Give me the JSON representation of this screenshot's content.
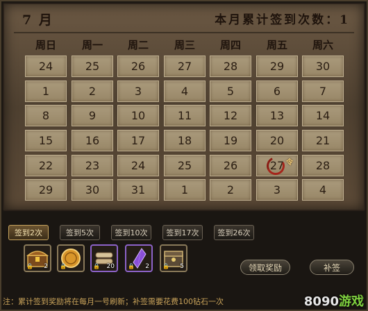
{
  "header": {
    "month": "7 月",
    "total_label": "本月累计签到次数：1"
  },
  "weekdays": [
    "周日",
    "周一",
    "周二",
    "周三",
    "周四",
    "周五",
    "周六"
  ],
  "calendar": [
    [
      "24",
      "25",
      "26",
      "27",
      "28",
      "29",
      "30"
    ],
    [
      "1",
      "2",
      "3",
      "4",
      "5",
      "6",
      "7"
    ],
    [
      "8",
      "9",
      "10",
      "11",
      "12",
      "13",
      "14"
    ],
    [
      "15",
      "16",
      "17",
      "18",
      "19",
      "20",
      "21"
    ],
    [
      "22",
      "23",
      "24",
      "25",
      "26",
      "27",
      "28"
    ],
    [
      "29",
      "30",
      "31",
      "1",
      "2",
      "3",
      "4"
    ]
  ],
  "today_marker": "令",
  "tabs": [
    "签到2次",
    "签到5次",
    "签到10次",
    "签到17次",
    "签到26次"
  ],
  "active_tab": 0,
  "rewards": [
    {
      "icon": "treasure-chest-icon",
      "qty": "2"
    },
    {
      "icon": "gold-coin-icon",
      "qty": ""
    },
    {
      "icon": "scroll-bundle-icon",
      "qty": "20"
    },
    {
      "icon": "purple-crystal-icon",
      "qty": "2"
    },
    {
      "icon": "ornate-chest-icon",
      "qty": "5"
    }
  ],
  "buttons": {
    "claim": "领取奖励",
    "resign": "补签"
  },
  "footer_note": "注：累计签到奖励将在每月一号刷新；补签需要花费100钻石一次",
  "watermark": {
    "part1": "8090",
    "part2": "游戏"
  },
  "colors": {
    "mark": "#a5251b",
    "active_tab": "#c7a45e",
    "note": "#c9a35a"
  }
}
